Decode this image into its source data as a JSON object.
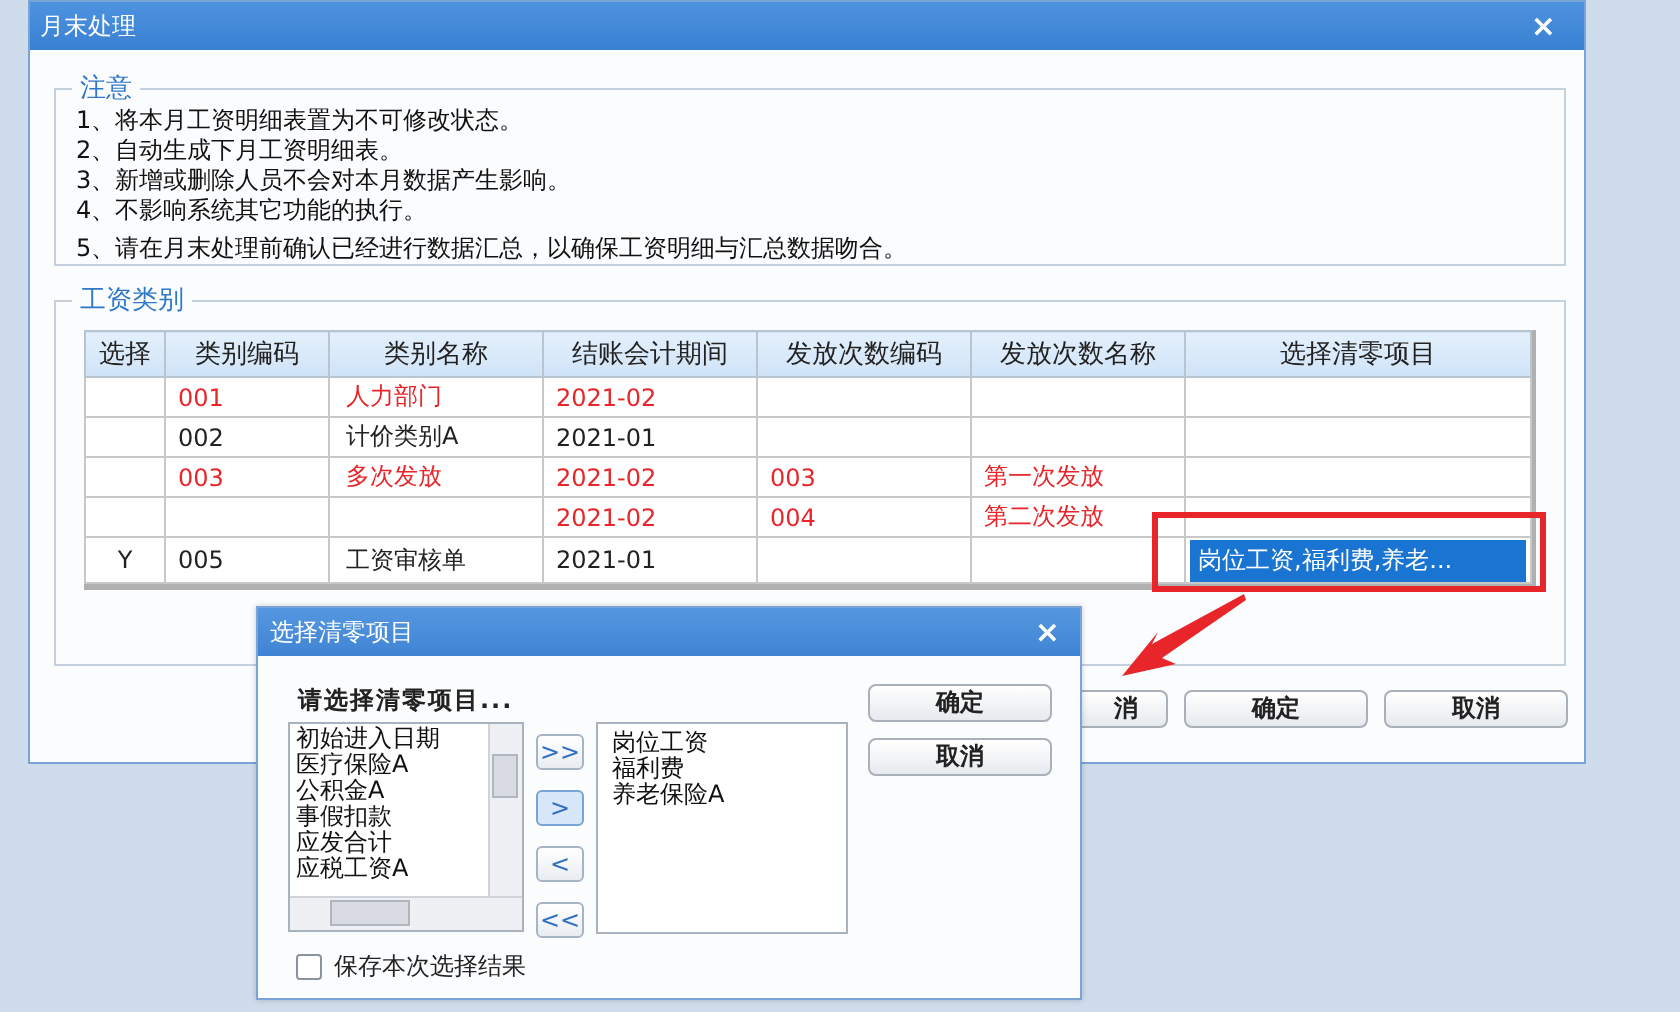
{
  "window": {
    "title": "月末处理",
    "close": "×"
  },
  "notice": {
    "legend": "注意",
    "lines": [
      "1、将本月工资明细表置为不可修改状态。",
      "2、自动生成下月工资明细表。",
      "3、新增或删除人员不会对本月数据产生影响。",
      "4、不影响系统其它功能的执行。",
      "5、请在月末处理前确认已经进行数据汇总，以确保工资明细与汇总数据吻合。"
    ]
  },
  "salary_types": {
    "legend": "工资类别",
    "table": {
      "columns": [
        "选择",
        "类别编码",
        "类别名称",
        "结账会计期间",
        "发放次数编码",
        "发放次数名称",
        "选择清零项目"
      ],
      "rows": [
        {
          "color": "#e8262a",
          "cells": [
            "",
            "001",
            "人力部门",
            "2021-02",
            "",
            "",
            ""
          ],
          "selected_cell": false
        },
        {
          "color": "#222222",
          "cells": [
            "",
            "002",
            "计价类别A",
            "2021-01",
            "",
            "",
            ""
          ],
          "selected_cell": false
        },
        {
          "color": "#e8262a",
          "cells": [
            "",
            "003",
            "多次发放",
            "2021-02",
            "003",
            "第一次发放",
            ""
          ],
          "selected_cell": false
        },
        {
          "color": "#e8262a",
          "cells": [
            "",
            "",
            "",
            "2021-02",
            "004",
            "第二次发放",
            ""
          ],
          "selected_cell": false
        },
        {
          "color": "#222222",
          "cells": [
            "Y",
            "005",
            "工资审核单",
            "2021-01",
            "",
            "",
            "岗位工资,福利费,养老..."
          ],
          "selected_cell": true
        }
      ]
    }
  },
  "buttons": [
    "消",
    "确定",
    "取消"
  ],
  "dialog": {
    "title": "选择清零项目",
    "close": "×",
    "prompt": "请选择清零项目...",
    "available": [
      "初始进入日期",
      "医疗保险A",
      "公积金A",
      "事假扣款",
      "应发合计",
      "应税工资A"
    ],
    "move_buttons": [
      {
        "label": ">>",
        "focused": false
      },
      {
        "label": ">",
        "focused": true
      },
      {
        "label": "<",
        "focused": false
      },
      {
        "label": "<<",
        "focused": false
      }
    ],
    "chosen": [
      "岗位工资",
      "福利费",
      "养老保险A"
    ],
    "buttons": [
      "确定",
      "取消"
    ],
    "save_choice": {
      "label": "保存本次选择结果",
      "checked": false
    }
  }
}
